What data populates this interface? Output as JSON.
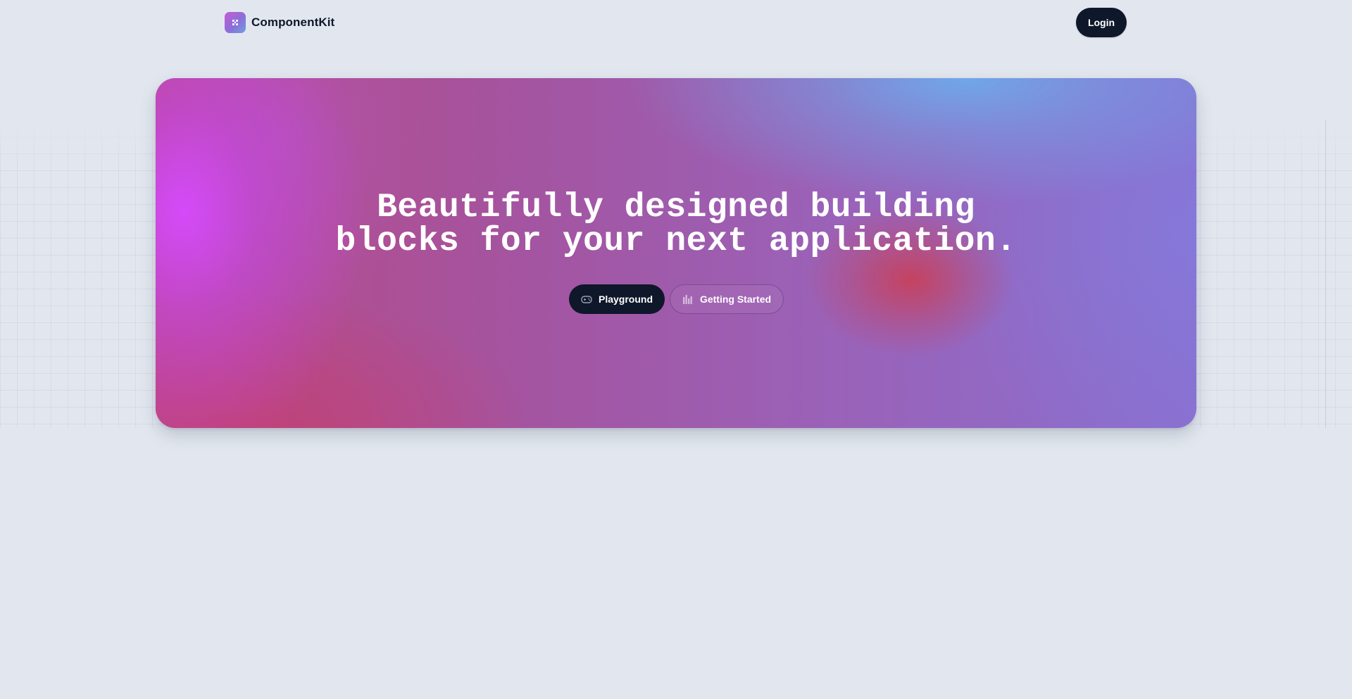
{
  "header": {
    "brand_name": "ComponentKit",
    "logo_icon": "puzzle-icon",
    "login_label": "Login"
  },
  "hero": {
    "title_line_1": "Beautifully designed building",
    "title_line_2": "blocks for your next application.",
    "buttons": [
      {
        "label": "Playground",
        "icon": "gamepad-icon"
      },
      {
        "label": "Getting Started",
        "icon": "bar-chart-icon"
      }
    ]
  },
  "colors": {
    "background": "#e2e7ef",
    "primary_button": "#0f172a",
    "hero_magenta": "#d64aff",
    "hero_blue": "#6eaaeb",
    "hero_red": "#cd3c50",
    "hero_purple": "#8a6fcf"
  }
}
